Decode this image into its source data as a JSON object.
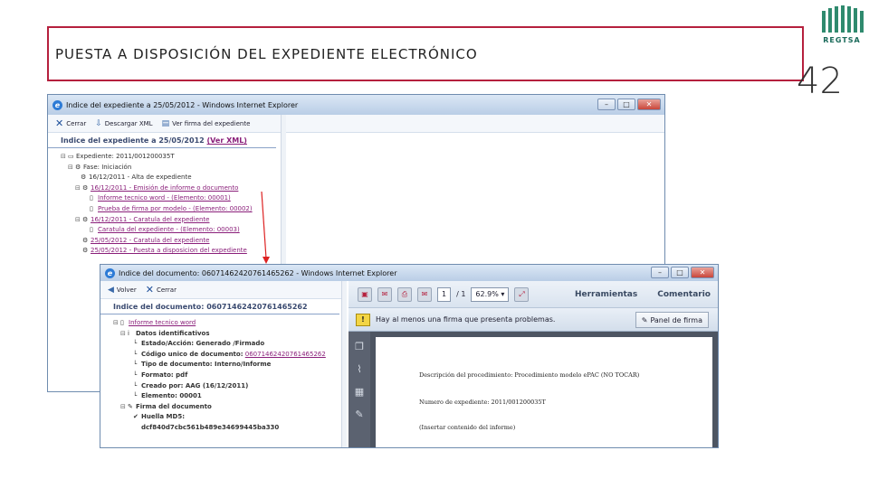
{
  "slide": {
    "title": "PUESTA A DISPOSICIÓN DEL EXPEDIENTE ELECTRÓNICO",
    "number": "42",
    "logo_text": "REGTSA"
  },
  "window1": {
    "title": "Indice del expediente a 25/05/2012 - Windows Internet Explorer",
    "toolbar": {
      "close_label": "Cerrar",
      "download_xml_label": "Descargar XML",
      "view_signature_label": "Ver firma del expediente"
    },
    "heading": "Indice del expediente a 25/05/2012",
    "heading_link": "(Ver XML)",
    "tree": [
      {
        "text": "Expediente: 2011/001200035T",
        "kind": "plain"
      },
      {
        "text": "Fase: Iniciación",
        "kind": "plain"
      },
      {
        "text": "16/12/2011 - Alta de expediente",
        "kind": "plain"
      },
      {
        "text": "16/12/2011 - Emisión de informe o documento",
        "kind": "link"
      },
      {
        "text": "Informe tecnico word - (Elemento: 00001)",
        "kind": "link"
      },
      {
        "text": "Prueba de firma por modelo - (Elemento: 00002)",
        "kind": "link"
      },
      {
        "text": "16/12/2011 - Caratula del expediente",
        "kind": "link"
      },
      {
        "text": "Caratula del expediente - (Elemento: 00003)",
        "kind": "link"
      },
      {
        "text": "25/05/2012 - Caratula del expediente",
        "kind": "link"
      },
      {
        "text": "25/05/2012 - Puesta a disposicion del expediente",
        "kind": "link"
      }
    ]
  },
  "window2": {
    "title": "Indice del documento: 06071462420761465262 - Windows Internet Explorer",
    "toolbar": {
      "back_label": "Volver",
      "close_label": "Cerrar"
    },
    "heading": "Indice del documento: 06071462420761465262",
    "tree": [
      {
        "text": "Informe tecnico word",
        "kind": "link"
      },
      {
        "text": "Datos identificativos",
        "kind": "bold"
      },
      {
        "text": "Estado/Acción: Generado /Firmado",
        "kind": "bold"
      },
      {
        "text": "Código unico de documento: 06071462420761465262",
        "kind": "mixed",
        "label": "Código unico de documento:",
        "value": "06071462420761465262"
      },
      {
        "text": "Tipo de documento: Interno/Informe",
        "kind": "bold"
      },
      {
        "text": "Formato: pdf",
        "kind": "bold"
      },
      {
        "text": "Creado por: AAG (16/12/2011)",
        "kind": "bold"
      },
      {
        "text": "Elemento: 00001",
        "kind": "bold"
      },
      {
        "text": "Firma del documento",
        "kind": "bold"
      },
      {
        "text": "Huella MD5:",
        "kind": "bold"
      },
      {
        "text": "dcf840d7cbc561b489e34699445ba330",
        "kind": "bold"
      }
    ]
  },
  "pdf": {
    "page_current": "1",
    "page_total": "/ 1",
    "zoom": "62.9%",
    "tools_label": "Herramientas",
    "comment_label": "Comentario",
    "warning_text": "Hay al menos una firma que presenta problemas.",
    "signature_panel_label": "Panel de firma",
    "content": [
      "Descripción del procedimiento: Procedimiento modelo ePAC (NO TOCAR)",
      "Numero de expediente: 2011/001200035T",
      "(Insertar contenido del informe)"
    ]
  }
}
